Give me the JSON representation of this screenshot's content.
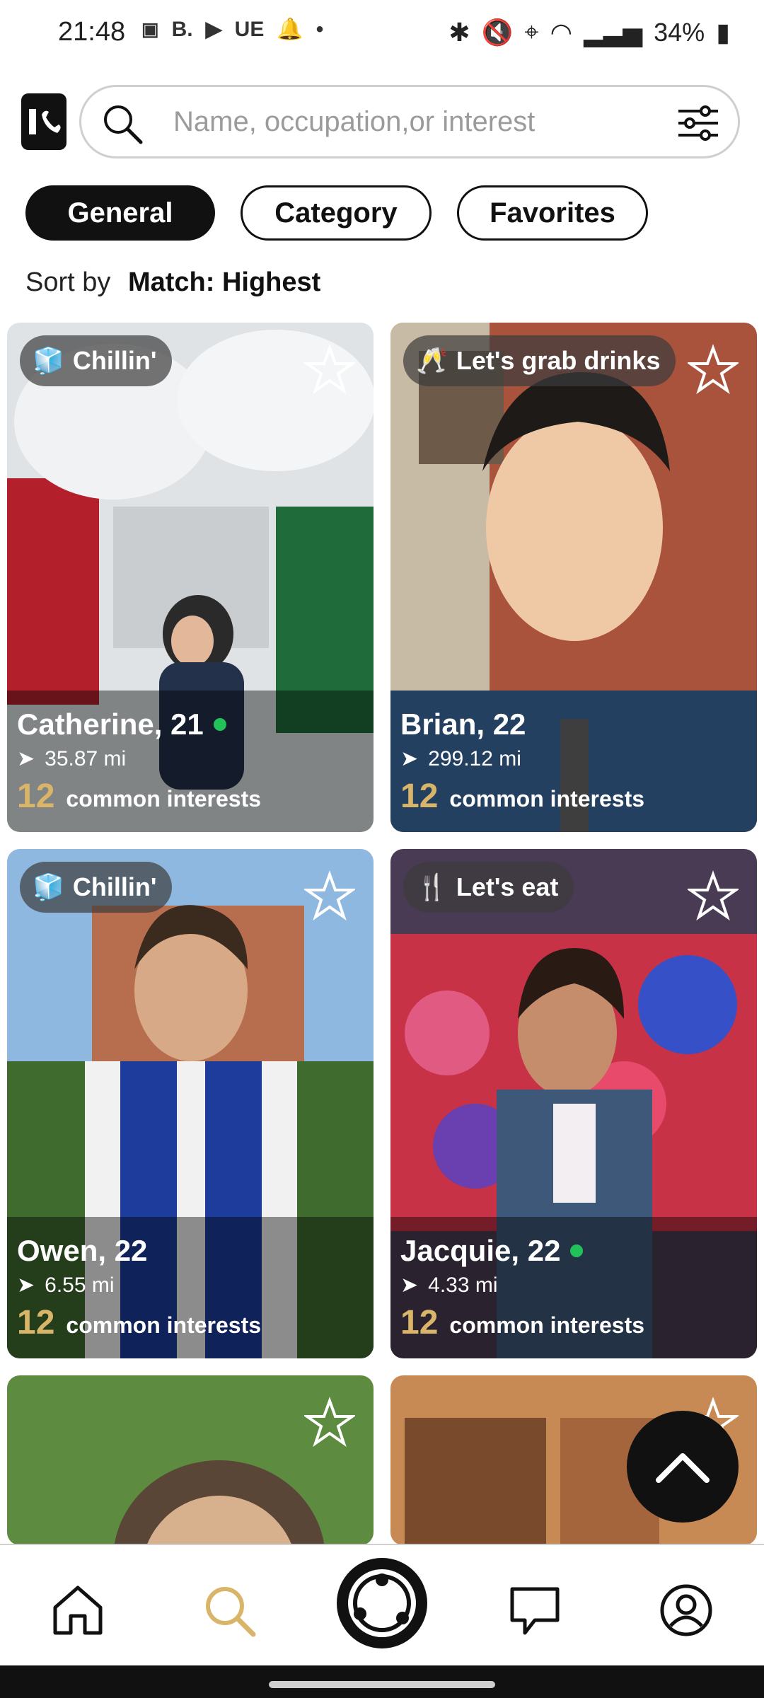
{
  "status": {
    "time": "21:48",
    "left_icons": [
      "notification-icon",
      "B.",
      "youtube-icon",
      "UE",
      "bell-icon",
      "•"
    ],
    "b_text": "B.",
    "ue_text": "UE",
    "dot_text": "•",
    "battery": "34%"
  },
  "search": {
    "placeholder": "Name, occupation,or interest"
  },
  "tabs": [
    {
      "label": "General",
      "active": true
    },
    {
      "label": "Category",
      "active": false
    },
    {
      "label": "Favorites",
      "active": false
    }
  ],
  "sort": {
    "label": "Sort by",
    "value": "Match: Highest"
  },
  "cards": [
    {
      "badge": "Chillin'",
      "badge_icon": "ice-cube-icon",
      "name": "Catherine, 21",
      "online": true,
      "distance": "35.87 mi",
      "common_count": "12",
      "common_text": "common interests"
    },
    {
      "badge": "Let's grab drinks",
      "badge_icon": "champagne-icon",
      "name": "Brian, 22",
      "online": false,
      "distance": "299.12 mi",
      "common_count": "12",
      "common_text": "common interests"
    },
    {
      "badge": "Chillin'",
      "badge_icon": "ice-cube-icon",
      "name": "Owen, 22",
      "online": false,
      "distance": "6.55 mi",
      "common_count": "12",
      "common_text": "common interests"
    },
    {
      "badge": "Let's eat",
      "badge_icon": "utensils-icon",
      "name": "Jacquie, 22",
      "online": true,
      "distance": "4.33 mi",
      "common_count": "12",
      "common_text": "common interests"
    }
  ],
  "nav": [
    "home-icon",
    "search-icon",
    "connections-icon",
    "messages-icon",
    "profile-icon"
  ],
  "colors": {
    "accent": "#d9b56a",
    "online": "#21c25a",
    "dark": "#111111"
  }
}
